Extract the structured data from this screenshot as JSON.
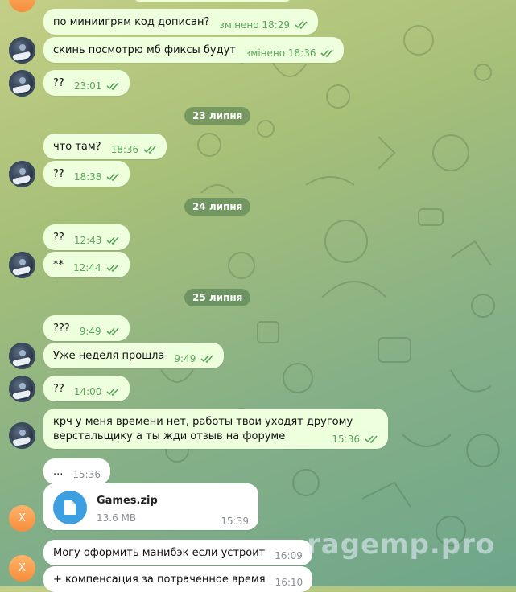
{
  "messages": [
    {
      "id": "m1",
      "text": "по миниигрям код дописан?",
      "meta": "змінено 18:29"
    },
    {
      "id": "m2",
      "text": "скинь посмотрю мб фиксы будут",
      "meta": "змінено 18:36"
    },
    {
      "id": "m3",
      "text": "??",
      "meta": "23:01"
    },
    {
      "id": "m4",
      "text": "что там?",
      "meta": "18:36"
    },
    {
      "id": "m5",
      "text": "??",
      "meta": "18:38"
    },
    {
      "id": "m6",
      "text": "??",
      "meta": "12:43"
    },
    {
      "id": "m7",
      "text": "**",
      "meta": "12:44"
    },
    {
      "id": "m8",
      "text": "???",
      "meta": "9:49"
    },
    {
      "id": "m9",
      "text": "Уже неделя прошла",
      "meta": "9:49"
    },
    {
      "id": "m10",
      "text": "??",
      "meta": "14:00"
    },
    {
      "id": "m11",
      "line1": "крч у меня времени нет, работы твои уходят другому",
      "line2": "верстальщику а ты жди отзыв на форуме",
      "meta": "15:36"
    },
    {
      "id": "m12",
      "text": "...",
      "meta": "15:36"
    },
    {
      "id": "m14",
      "text": "Могу оформить манибэк если устроит",
      "meta": "16:09"
    },
    {
      "id": "m15",
      "text": "+ компенсация за потраченное время",
      "meta": "16:10"
    }
  ],
  "dates": {
    "d1": "23 липня",
    "d2": "24 липня",
    "d3": "25 липня"
  },
  "file": {
    "name": "Games.zip",
    "size": "13.6 MB",
    "time": "15:39"
  },
  "avatar_x_letter": "X",
  "watermark": "ragemp.pro",
  "colors": {
    "outgoing": "#eeffde",
    "incoming": "#ffffff",
    "check": "#5aa55a",
    "file_icon": "#3d9fe0",
    "avatar_x": "#f58d3c"
  },
  "icons": [
    "double-check-icon",
    "file-icon",
    "user-avatar-icon"
  ]
}
